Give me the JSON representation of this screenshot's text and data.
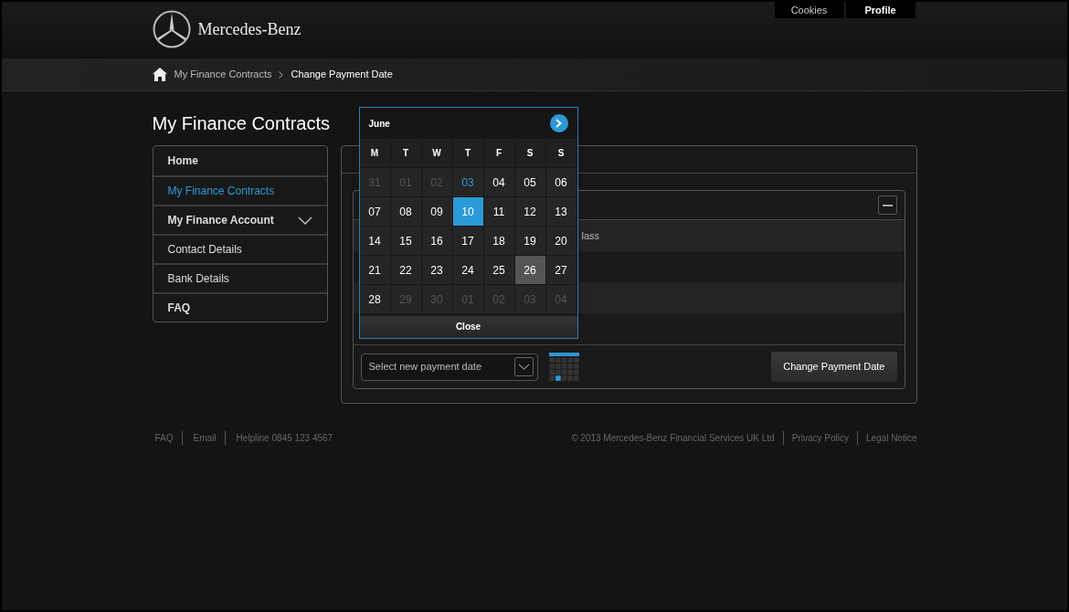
{
  "header": {
    "brand": "Mercedes-Benz",
    "top_links": [
      {
        "label": "Cookies",
        "selected": false
      },
      {
        "label": "Profile",
        "selected": true
      }
    ]
  },
  "breadcrumb": [
    "My Finance Contracts",
    "Change Payment Date"
  ],
  "page_title": "My Finance Contracts",
  "sidebar": {
    "items": [
      {
        "label": "Home",
        "selected": false,
        "bold": true,
        "expandable": false
      },
      {
        "label": "My Finance Contracts",
        "selected": true,
        "bold": false,
        "expandable": false
      },
      {
        "label": "My Finance Account",
        "selected": false,
        "bold": true,
        "expandable": true
      },
      {
        "label": "Contact Details",
        "selected": false,
        "bold": false,
        "expandable": false
      },
      {
        "label": "Bank Details",
        "selected": false,
        "bold": false,
        "expandable": false
      },
      {
        "label": "FAQ",
        "selected": false,
        "bold": true,
        "expandable": false
      }
    ]
  },
  "contract_panel": {
    "rows": [
      "lass",
      "",
      "",
      ""
    ],
    "date_select": {
      "placeholder": "Select new payment date"
    },
    "submit": "Change Payment Date"
  },
  "calendar": {
    "month": "June",
    "weekdays": [
      "M",
      "T",
      "W",
      "T",
      "F",
      "S",
      "S"
    ],
    "days": [
      {
        "label": "31",
        "muted": true,
        "today": false,
        "selected": false,
        "hovered": false
      },
      {
        "label": "01",
        "muted": true,
        "today": false,
        "selected": false,
        "hovered": false
      },
      {
        "label": "02",
        "muted": true,
        "today": false,
        "selected": false,
        "hovered": false
      },
      {
        "label": "03",
        "muted": false,
        "today": true,
        "selected": false,
        "hovered": false
      },
      {
        "label": "04",
        "muted": false,
        "today": false,
        "selected": false,
        "hovered": false
      },
      {
        "label": "05",
        "muted": false,
        "today": false,
        "selected": false,
        "hovered": false
      },
      {
        "label": "06",
        "muted": false,
        "today": false,
        "selected": false,
        "hovered": false
      },
      {
        "label": "07",
        "muted": false,
        "today": false,
        "selected": false,
        "hovered": false
      },
      {
        "label": "08",
        "muted": false,
        "today": false,
        "selected": false,
        "hovered": false
      },
      {
        "label": "09",
        "muted": false,
        "today": false,
        "selected": false,
        "hovered": false
      },
      {
        "label": "10",
        "muted": false,
        "today": false,
        "selected": true,
        "hovered": false
      },
      {
        "label": "11",
        "muted": false,
        "today": false,
        "selected": false,
        "hovered": false
      },
      {
        "label": "12",
        "muted": false,
        "today": false,
        "selected": false,
        "hovered": false
      },
      {
        "label": "13",
        "muted": false,
        "today": false,
        "selected": false,
        "hovered": false
      },
      {
        "label": "14",
        "muted": false,
        "today": false,
        "selected": false,
        "hovered": false
      },
      {
        "label": "15",
        "muted": false,
        "today": false,
        "selected": false,
        "hovered": false
      },
      {
        "label": "16",
        "muted": false,
        "today": false,
        "selected": false,
        "hovered": false
      },
      {
        "label": "17",
        "muted": false,
        "today": false,
        "selected": false,
        "hovered": false
      },
      {
        "label": "18",
        "muted": false,
        "today": false,
        "selected": false,
        "hovered": false
      },
      {
        "label": "19",
        "muted": false,
        "today": false,
        "selected": false,
        "hovered": false
      },
      {
        "label": "20",
        "muted": false,
        "today": false,
        "selected": false,
        "hovered": false
      },
      {
        "label": "21",
        "muted": false,
        "today": false,
        "selected": false,
        "hovered": false
      },
      {
        "label": "22",
        "muted": false,
        "today": false,
        "selected": false,
        "hovered": false
      },
      {
        "label": "23",
        "muted": false,
        "today": false,
        "selected": false,
        "hovered": false
      },
      {
        "label": "24",
        "muted": false,
        "today": false,
        "selected": false,
        "hovered": false
      },
      {
        "label": "25",
        "muted": false,
        "today": false,
        "selected": false,
        "hovered": false
      },
      {
        "label": "26",
        "muted": false,
        "today": false,
        "selected": false,
        "hovered": true
      },
      {
        "label": "27",
        "muted": false,
        "today": false,
        "selected": false,
        "hovered": false
      },
      {
        "label": "28",
        "muted": false,
        "today": false,
        "selected": false,
        "hovered": false
      },
      {
        "label": "29",
        "muted": true,
        "today": false,
        "selected": false,
        "hovered": false
      },
      {
        "label": "30",
        "muted": true,
        "today": false,
        "selected": false,
        "hovered": false
      },
      {
        "label": "01",
        "muted": true,
        "today": false,
        "selected": false,
        "hovered": false
      },
      {
        "label": "02",
        "muted": true,
        "today": false,
        "selected": false,
        "hovered": false
      },
      {
        "label": "03",
        "muted": true,
        "today": false,
        "selected": false,
        "hovered": false
      },
      {
        "label": "04",
        "muted": true,
        "today": false,
        "selected": false,
        "hovered": false
      }
    ],
    "close": "Close"
  },
  "footer": {
    "left": [
      "FAQ",
      "Email",
      "Helpline 0845 123 4567"
    ],
    "right": [
      "© 2013 Mercedes-Benz Financial Services UK Ltd",
      "Privacy Policy",
      "Legal Notice"
    ]
  }
}
